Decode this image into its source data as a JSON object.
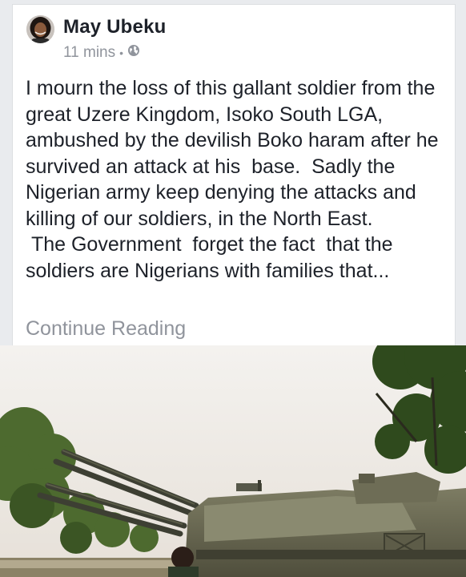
{
  "post": {
    "author": "May Ubeku",
    "timestamp": "11 mins",
    "separator": "•",
    "audience_icon": "globe-icon",
    "paragraph_1": "I mourn the loss of this gallant soldier from the great Uzere Kingdom, Isoko South LGA, ambushed by the devilish Boko haram after he survived an attack at his  base.  Sadly the Nigerian army keep denying the attacks and killing of our soldiers, in the North East.",
    "paragraph_2": " The Government  forget the fact  that the soldiers are Nigerians with families that...",
    "continue_label": "Continue Reading"
  },
  "photo": {
    "subject": "anti-aircraft-gun-vehicle"
  },
  "colors": {
    "text": "#1d2129",
    "muted": "#90949c",
    "card": "#ffffff",
    "page": "#e9ebee"
  }
}
